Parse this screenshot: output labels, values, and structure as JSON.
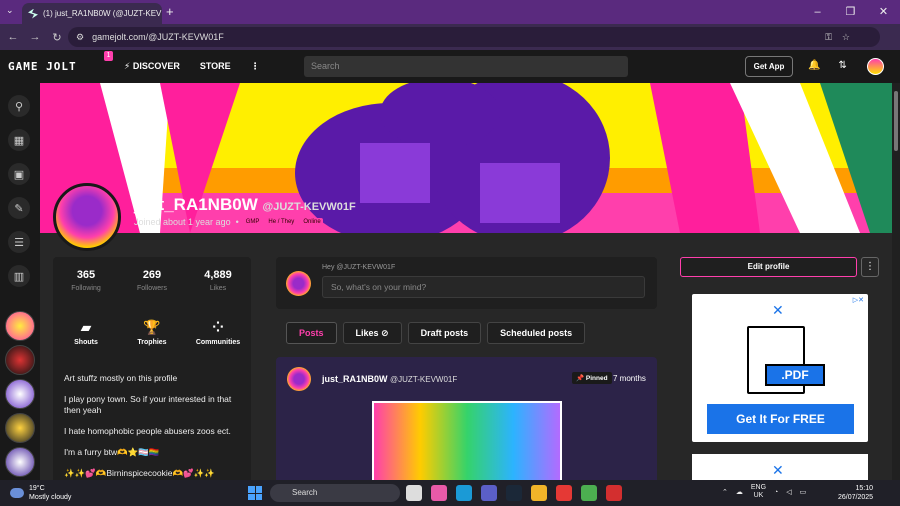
{
  "browser": {
    "tab_title": "(1) just_RA1NB0W (@JUZT-KEV",
    "url": "gamejolt.com/@JUZT-KEVW01F"
  },
  "gj": {
    "logo": "GAME JOLT",
    "notif_count": "1",
    "nav_discover": "DISCOVER",
    "nav_store": "STORE",
    "search_placeholder": "Search",
    "get_app": "Get App"
  },
  "profile": {
    "name": "just_RA1NB0W",
    "handle": "@JUZT-KEVW01F",
    "joined": "Joined about 1 year ago",
    "tags": [
      "GMP",
      "He / They",
      "Online"
    ],
    "stats": [
      {
        "value": "365",
        "label": "Following"
      },
      {
        "value": "269",
        "label": "Followers"
      },
      {
        "value": "4,889",
        "label": "Likes"
      }
    ],
    "links": [
      "Shouts",
      "Trophies",
      "Communities"
    ],
    "bio": [
      "Art stuffz mostly on this profile",
      "I play pony town. So if your interested in that then yeah",
      "I hate homophobic people abusers zoos ect.",
      "I'm a furry btw🫶⭐🏳️‍⚧️🏳️‍🌈",
      "✨✨💕🫶Birninspicecookie🫶💕✨✨"
    ]
  },
  "composer": {
    "hey": "Hey @JUZT-KEVW01F",
    "placeholder": "So, what's on your mind?"
  },
  "post_tabs": [
    "Posts",
    "Likes",
    "Draft posts",
    "Scheduled posts"
  ],
  "post": {
    "author": "just_RA1NB0W",
    "handle": "@JUZT-KEVW01F",
    "pinned": "Pinned",
    "age": "7 months"
  },
  "right": {
    "edit_profile": "Edit profile",
    "ad_badge": "PDF",
    "ad_button": "Get It For FREE"
  },
  "taskbar": {
    "temp": "19°C",
    "weather": "Mostly cloudy",
    "search": "Search",
    "lang1": "ENG",
    "lang2": "UK",
    "time": "15:10",
    "date": "26/07/2025"
  },
  "colors": {
    "accent": "#ff3fac",
    "brand_purple": "#5a2a7e"
  }
}
